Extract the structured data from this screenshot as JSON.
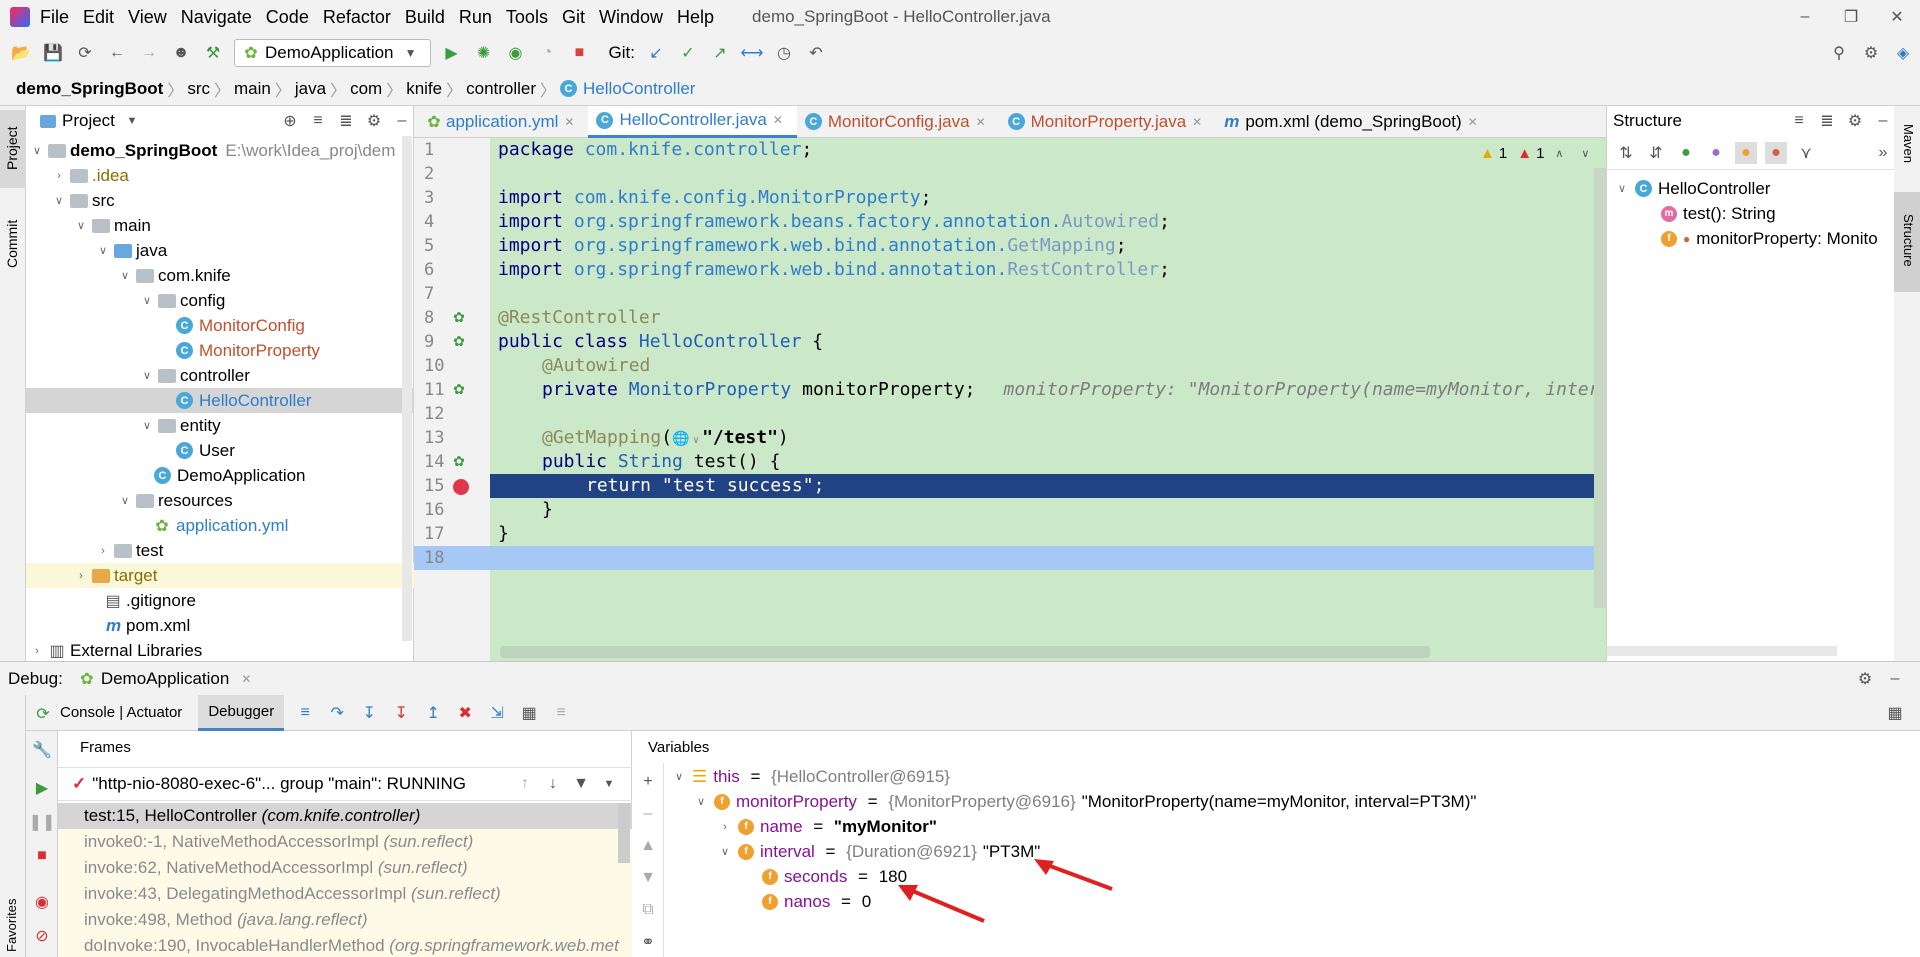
{
  "menubar": {
    "items": [
      "File",
      "Edit",
      "View",
      "Navigate",
      "Code",
      "Refactor",
      "Build",
      "Run",
      "Tools",
      "Git",
      "Window",
      "Help"
    ],
    "window_title": "demo_SpringBoot - HelloController.java"
  },
  "toolbar": {
    "run_config": "DemoApplication",
    "git_label": "Git:"
  },
  "breadcrumb": [
    "demo_SpringBoot",
    "src",
    "main",
    "java",
    "com",
    "knife",
    "controller",
    "HelloController"
  ],
  "project": {
    "title": "Project",
    "root_name": "demo_SpringBoot",
    "root_path": "E:\\work\\Idea_proj\\dem",
    "items": [
      ".idea",
      "src",
      "main",
      "java",
      "com.knife",
      "config",
      "MonitorConfig",
      "MonitorProperty",
      "controller",
      "HelloController",
      "entity",
      "User",
      "DemoApplication",
      "resources",
      "application.yml",
      "test",
      "target",
      ".gitignore",
      "pom.xml",
      "External Libraries"
    ]
  },
  "sidetools": {
    "project": "Project",
    "commit": "Commit",
    "favorites": "Favorites",
    "maven": "Maven",
    "structure": "Structure"
  },
  "editor": {
    "tabs": [
      "application.yml",
      "HelloController.java",
      "MonitorConfig.java",
      "MonitorProperty.java",
      "pom.xml (demo_SpringBoot)"
    ],
    "warn_count": "1",
    "error_count": "1",
    "line_numbers": [
      "1",
      "2",
      "3",
      "4",
      "5",
      "6",
      "7",
      "8",
      "9",
      "10",
      "11",
      "12",
      "13",
      "14",
      "15",
      "16",
      "17",
      "18"
    ],
    "code": {
      "l1_kw": "package ",
      "l1_pk": "com.knife.controller",
      "l1_end": ";",
      "l3_kw": "import ",
      "l3_pk": "com.knife.config.MonitorProperty",
      "l4_pk": "org.springframework.beans.factory.annotation.",
      "l4_cl": "Autowired",
      "l5_pk": "org.springframework.web.bind.annotation.",
      "l5_cl": "GetMapping",
      "l6_cl": "RestController",
      "semi": ";",
      "l8": "@RestController",
      "l9_kw": "public class ",
      "l9_cn": "HelloController",
      "l9_end": " {",
      "l10": "@Autowired",
      "l11_kw": "private ",
      "l11_type": "MonitorProperty",
      "l11_name": " monitorProperty;",
      "l11_hint": "monitorProperty: \"MonitorProperty(name=myMonitor, inter",
      "l13_an": "@GetMapping",
      "l13_open": "(",
      "l13_str": "\"/test\"",
      "l13_close": ")",
      "l14_kw": "public ",
      "l14_type": "String",
      "l14_rest": " test() {",
      "l15": "return \"test success\";",
      "l16": "}",
      "l17": "}"
    }
  },
  "structure": {
    "title": "Structure",
    "class": "HelloController",
    "method": "test(): String",
    "field": "monitorProperty: Monito"
  },
  "debug": {
    "label": "Debug:",
    "config": "DemoApplication",
    "tab_console": "Console | Actuator",
    "tab_debugger": "Debugger",
    "frames_title": "Frames",
    "variables_title": "Variables",
    "thread": "\"http-nio-8080-exec-6\"... group \"main\": RUNNING",
    "frames": [
      {
        "method": "test:15, HelloController",
        "pkg": "(com.knife.controller)"
      },
      {
        "method": "invoke0:-1, NativeMethodAccessorImpl",
        "pkg": "(sun.reflect)"
      },
      {
        "method": "invoke:62, NativeMethodAccessorImpl",
        "pkg": "(sun.reflect)"
      },
      {
        "method": "invoke:43, DelegatingMethodAccessorImpl",
        "pkg": "(sun.reflect)"
      },
      {
        "method": "invoke:498, Method",
        "pkg": "(java.lang.reflect)"
      },
      {
        "method": "doInvoke:190, InvocableHandlerMethod",
        "pkg": "(org.springframework.web.met"
      }
    ],
    "vars": {
      "this_name": "this",
      "this_val": "{HelloController@6915}",
      "mp_name": "monitorProperty",
      "mp_type": "{MonitorProperty@6916}",
      "mp_str": "\"MonitorProperty(name=myMonitor, interval=PT3M)\"",
      "name_name": "name",
      "name_val": "\"myMonitor\"",
      "interval_name": "interval",
      "interval_type": "{Duration@6921}",
      "interval_str": "\"PT3M\"",
      "seconds_name": "seconds",
      "seconds_val": "180",
      "nanos_name": "nanos",
      "nanos_val": "0",
      "eq": " = "
    }
  },
  "colors": {
    "accent": "#2e5fb5",
    "annotation_arrow": "#e02020",
    "code_bg": "#cbe8c9",
    "selected_line": "#214283"
  }
}
